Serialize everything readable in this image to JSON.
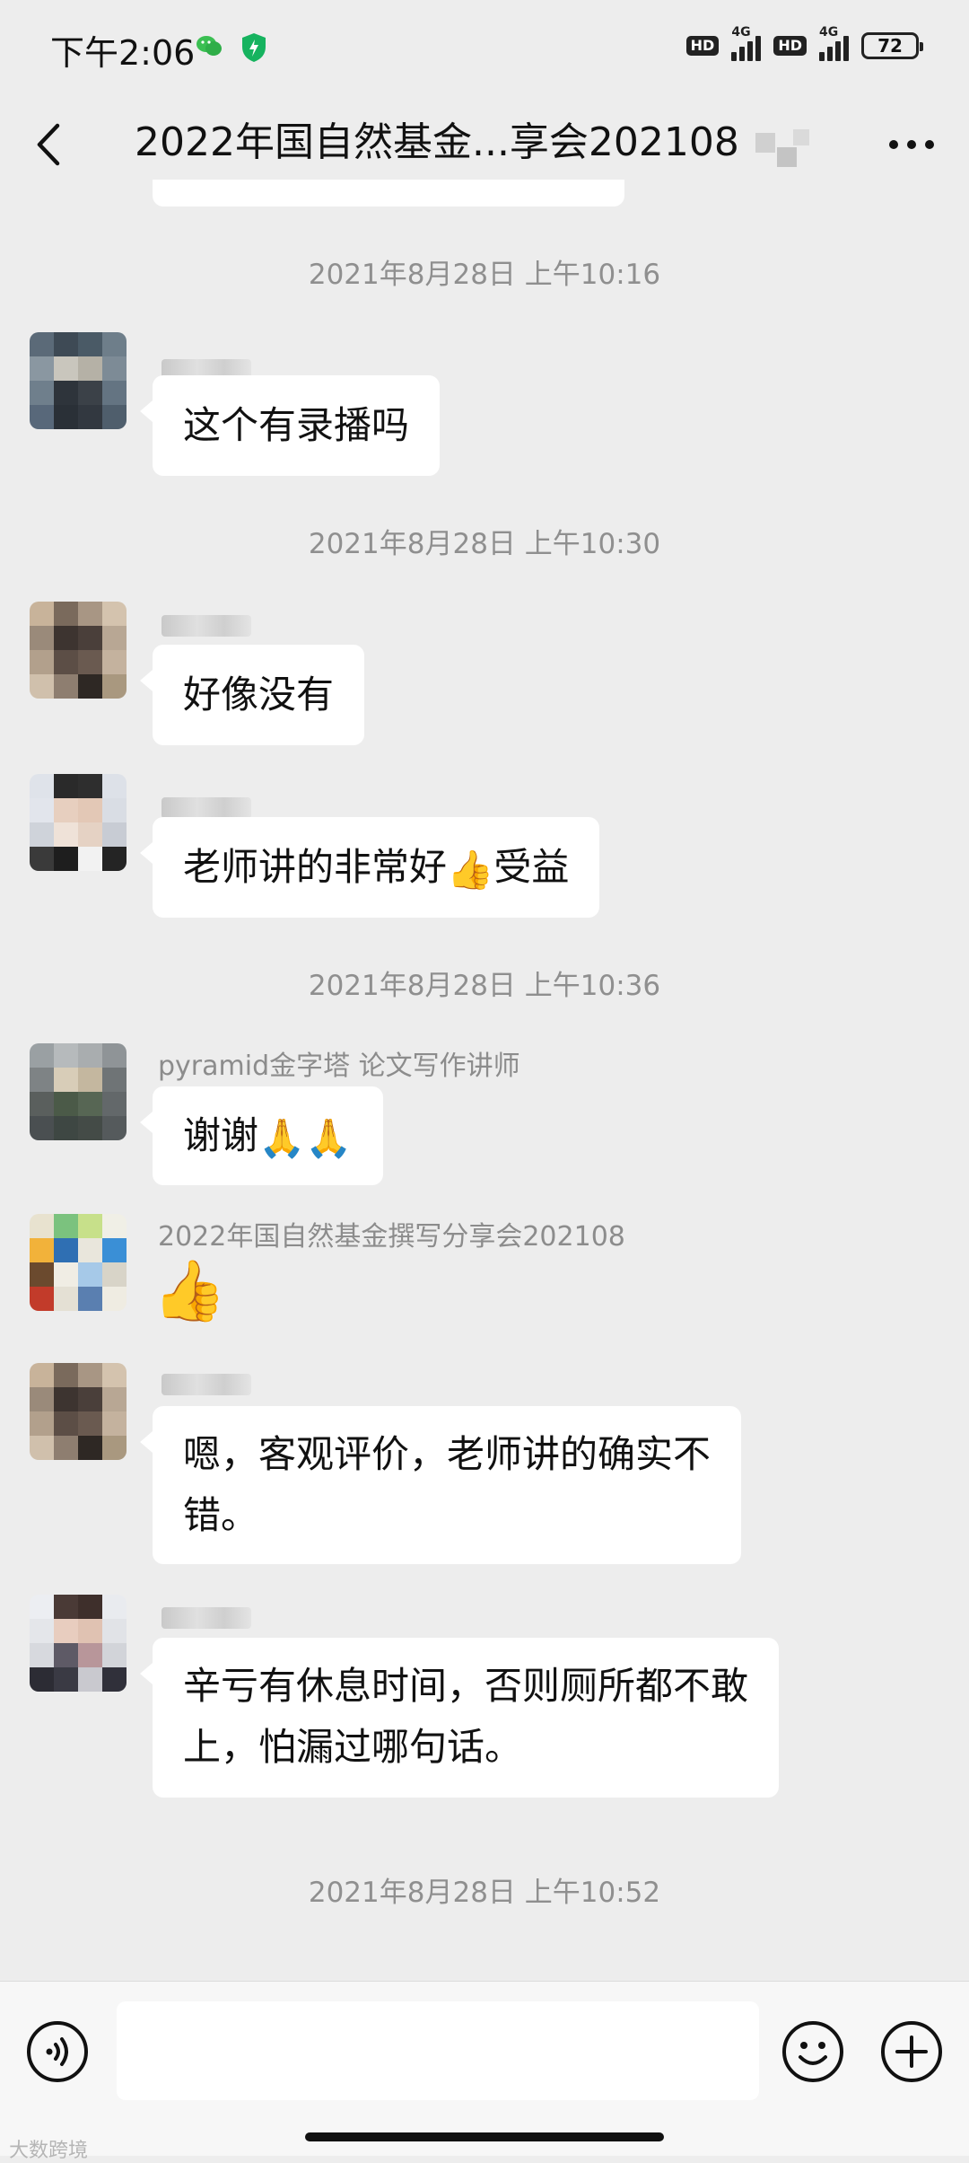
{
  "status_bar": {
    "time": "下午2:06",
    "hd1": "HD",
    "net1": "4G",
    "hd2": "HD",
    "net2": "4G",
    "battery": "72",
    "icons": [
      "wechat-icon",
      "shield-icon",
      "signal-icon",
      "battery-icon"
    ]
  },
  "navbar": {
    "title": "2022年国自然基金...享会202108",
    "title_tail": ")",
    "back_icon": "chevron-left-icon",
    "more_icon": "more-dots-icon"
  },
  "messages": {
    "t1": "2021年8月28日 上午10:16",
    "m1": {
      "text": "这个有录播吗"
    },
    "t2": "2021年8月28日 上午10:30",
    "m2": {
      "text": "好像没有"
    },
    "m3": {
      "text": "老师讲的非常好",
      "emoji": "👍",
      "text_after": "受益"
    },
    "t3": "2021年8月28日 上午10:36",
    "m4": {
      "nickname": "pyramid金字塔 论文写作讲师",
      "text": "谢谢",
      "emoji": "🙏🙏"
    },
    "m5": {
      "nickname": "2022年国自然基金撰写分享会202108",
      "emoji": "👍"
    },
    "m6": {
      "line1": "嗯，客观评价，老师讲的确实不",
      "line2": "错。"
    },
    "m7": {
      "line1": "辛亏有休息时间，否则厕所都不敢",
      "line2": "上，怕漏过哪句话。"
    },
    "t4": "2021年8月28日 上午10:52"
  },
  "input_bar": {
    "placeholder": "",
    "voice_icon": "voice-icon",
    "emoji_icon": "emoji-icon",
    "plus_icon": "plus-icon",
    "watermark": "大数跨境"
  },
  "colors": {
    "background": "#ededed",
    "bubble": "#ffffff",
    "timestamp": "#8f8f8f"
  }
}
